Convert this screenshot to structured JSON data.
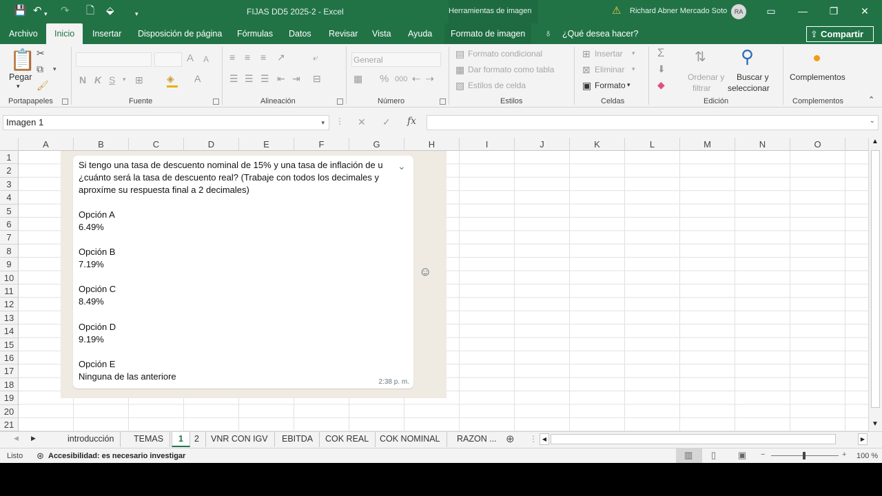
{
  "titlebar": {
    "doc_title": "FIJAS DD5 2025-2  -  Excel",
    "context_tool": "Herramientas de imagen",
    "user_name": "Richard  Abner Mercado Soto",
    "user_initials": "RA"
  },
  "ribbon_tabs": [
    "Archivo",
    "Inicio",
    "Insertar",
    "Disposición de página",
    "Fórmulas",
    "Datos",
    "Revisar",
    "Vista",
    "Ayuda",
    "Formato de imagen"
  ],
  "active_tab": "Inicio",
  "tell_me": "¿Qué desea hacer?",
  "share_label": "Compartir",
  "ribbon": {
    "clipboard": {
      "paste": "Pegar",
      "label": "Portapapeles"
    },
    "font": {
      "bold": "N",
      "italic": "K",
      "underline": "S",
      "grow": "A",
      "shrink": "A",
      "label": "Fuente"
    },
    "alignment": {
      "label": "Alineación"
    },
    "number": {
      "format": "General",
      "percent": "%",
      "thousands": "000",
      "label": "Número"
    },
    "styles": {
      "conditional": "Formato condicional",
      "table": "Dar formato como tabla",
      "cell_styles": "Estilos de celda",
      "label": "Estilos"
    },
    "cells": {
      "insert": "Insertar",
      "delete": "Eliminar",
      "format": "Formato",
      "label": "Celdas"
    },
    "editing": {
      "sort_1": "Ordenar y",
      "sort_2": "filtrar",
      "find_1": "Buscar y",
      "find_2": "seleccionar",
      "label": "Edición"
    },
    "addins": {
      "addins": "Complementos",
      "label": "Complementos"
    }
  },
  "namebox": "Imagen 1",
  "formula_fx": "fx",
  "columns": [
    "A",
    "B",
    "C",
    "D",
    "E",
    "F",
    "G",
    "H",
    "I",
    "J",
    "K",
    "L",
    "M",
    "N",
    "O"
  ],
  "rows": [
    "1",
    "2",
    "3",
    "4",
    "5",
    "6",
    "7",
    "8",
    "9",
    "10",
    "11",
    "12",
    "13",
    "14",
    "15",
    "16",
    "17",
    "18",
    "19",
    "20",
    "21"
  ],
  "chat": {
    "q1": "Si tengo una tasa de descuento nominal de 15% y una tasa de inflación de u",
    "q2": "¿cuánto será la tasa de descuento real? (Trabaje con todos los decimales y",
    "q3": "aproxíme su respuesta final a 2 decimales)",
    "options": [
      {
        "label": "Opción A",
        "value": "6.49%"
      },
      {
        "label": "Opción B",
        "value": "7.19%"
      },
      {
        "label": "Opción C",
        "value": "8.49%"
      },
      {
        "label": "Opción D",
        "value": "9.19%"
      },
      {
        "label": "Opción E",
        "value": "Ninguna de las anteriore"
      }
    ],
    "time": "2:38 p. m."
  },
  "sheets": [
    "introducción",
    "TEMAS",
    "1",
    "2",
    "VNR CON IGV",
    "EBITDA",
    "COK REAL",
    "COK NOMINAL",
    "RAZON ..."
  ],
  "active_sheet": "1",
  "status": {
    "ready": "Listo",
    "accessibility": "Accesibilidad: es necesario investigar",
    "zoom": "100 %"
  },
  "colors": {
    "excel_green": "#217346",
    "ribbon_bg": "#f3f3f3",
    "chat_bg": "#efeae2"
  }
}
